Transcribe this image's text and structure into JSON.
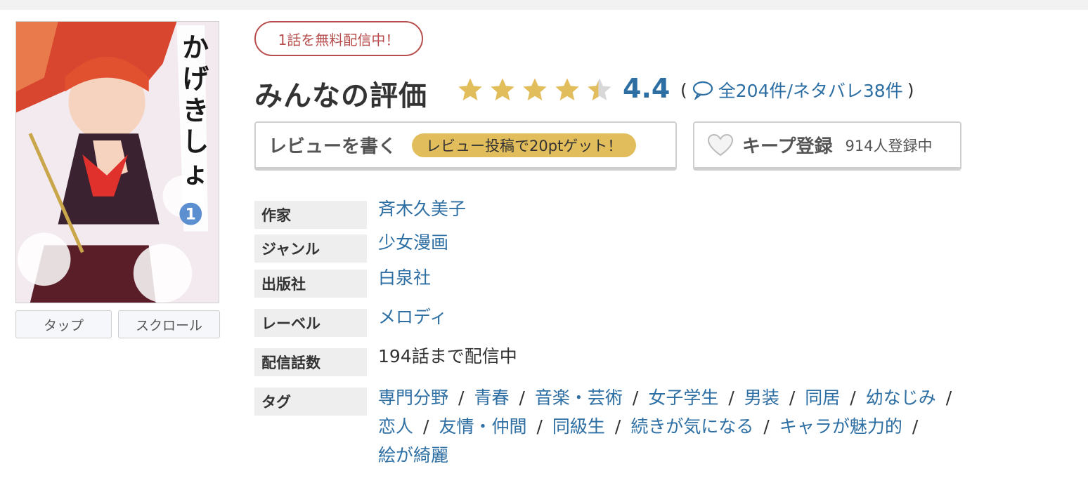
{
  "cover": {
    "title_art": "かげきしょうじょ!!",
    "volume": "1",
    "view_buttons": [
      "タップ",
      "スクロール"
    ]
  },
  "free_badge": "1話を無料配信中！",
  "rating": {
    "title": "みんなの評価",
    "stars_filled": 4.4,
    "stars_total": 5,
    "score": "4.4",
    "paren_open": "(",
    "paren_close": ")",
    "count_text": "全204件/ネタバレ38件",
    "icon": "speech-bubble-icon",
    "colors": {
      "star": "#e2bd5c",
      "star_empty": "#d8d8d8",
      "link": "#2d6ea3"
    }
  },
  "review_button": {
    "label": "レビューを書く",
    "pill": "レビュー投稿で20ptゲット！"
  },
  "keep_button": {
    "icon": "heart-icon",
    "label": "キープ登録",
    "count": "914人登録中"
  },
  "info": {
    "author_label": "作家",
    "author": "斉木久美子",
    "genre_label": "ジャンル",
    "genre": "少女漫画",
    "publisher_label": "出版社",
    "publisher": "白泉社",
    "label_label": "レーベル",
    "label": "メロディ",
    "episodes_label": "配信話数",
    "episodes": "194話まで配信中",
    "tags_label": "タグ",
    "tags": [
      "専門分野",
      "青春",
      "音楽・芸術",
      "女子学生",
      "男装",
      "同居",
      "幼なじみ",
      "恋人",
      "友情・仲間",
      "同級生",
      "続きが気になる",
      "キャラが魅力的",
      "絵が綺麗"
    ],
    "tag_separator": "/"
  }
}
